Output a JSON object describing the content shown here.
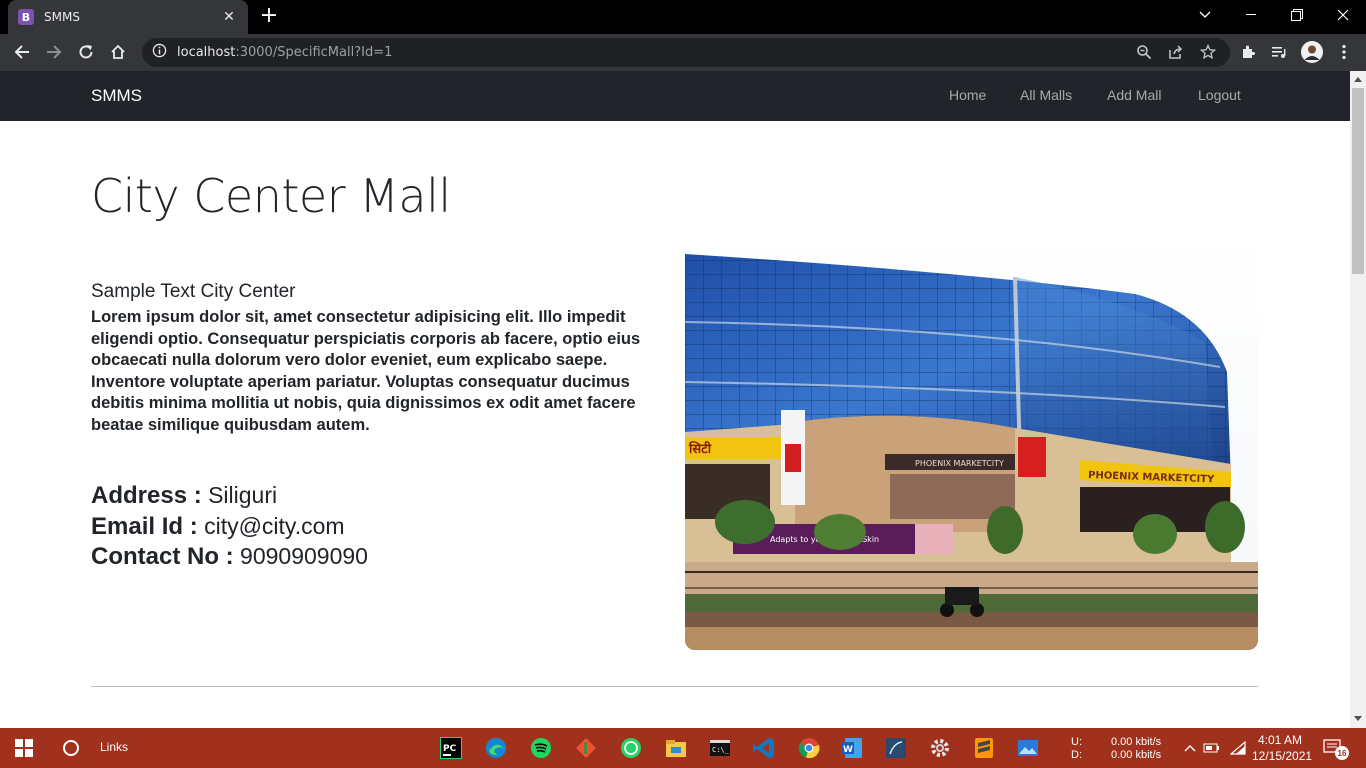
{
  "browser": {
    "tab_title": "SMMS",
    "tab_favicon_letter": "B",
    "url_host": "localhost",
    "url_rest": ":3000/SpecificMall?Id=1",
    "icons": [
      "back-icon",
      "forward-icon",
      "reload-icon",
      "home-icon",
      "info-icon",
      "zoom-icon",
      "share-icon",
      "star-icon",
      "extensions-icon",
      "media-icon",
      "profile-avatar",
      "menu-icon"
    ]
  },
  "navbar": {
    "brand": "SMMS",
    "links": [
      "Home",
      "All Malls",
      "Add Mall",
      "Logout"
    ]
  },
  "mall": {
    "title": "City Center Mall",
    "subtitle": "Sample Text City Center",
    "description": "Lorem ipsum dolor sit, amet consectetur adipisicing elit. Illo impedit eligendi optio. Consequatur perspiciatis corporis ab facere, optio eius obcaecati nulla dolorum vero dolor eveniet, eum explicabo saepe. Inventore voluptate aperiam pariatur. Voluptas consequatur ducimus debitis minima mollitia ut nobis, quia dignissimos ex odit amet facere beatae similique quibusdam autem.",
    "address_label": "Address :",
    "address": "Siliguri",
    "email_label": "Email Id :",
    "email": "city@city.com",
    "contact_label": "Contact No :",
    "contact": "9090909090",
    "image_signage": [
      "PHOENIX MARKETCITY",
      "Adapts to your Unique Skin"
    ]
  },
  "taskbar": {
    "search_label": "Links",
    "net_up_label": "U:",
    "net_down_label": "D:",
    "net_up": "0.00 kbit/s",
    "net_down": "0.00 kbit/s",
    "time": "4:01 AM",
    "date": "12/15/2021",
    "notifications": "16",
    "apps": [
      "pycharm-icon",
      "edge-icon",
      "spotify-icon",
      "git-icon",
      "whatsapp-icon",
      "file-explorer-icon",
      "terminal-icon",
      "vscode-icon",
      "chrome-icon",
      "word-icon",
      "sql-icon",
      "settings-icon",
      "sublime-icon",
      "photos-icon"
    ]
  }
}
